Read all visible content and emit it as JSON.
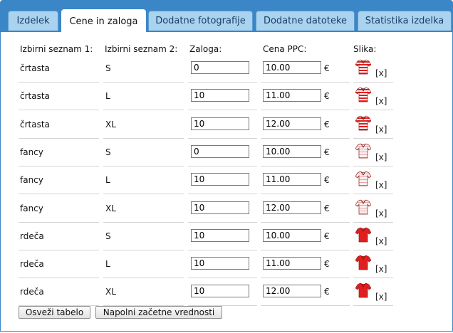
{
  "tabs": [
    {
      "label": "Izdelek"
    },
    {
      "label": "Cene in zaloga"
    },
    {
      "label": "Dodatne fotografije"
    },
    {
      "label": "Dodatne datoteke"
    },
    {
      "label": "Statistika izdelka"
    }
  ],
  "headers": {
    "list1": "Izbirni seznam 1:",
    "list2": "Izbirni seznam 2:",
    "stock": "Zaloga:",
    "price": "Cena PPC:",
    "image": "Slika:"
  },
  "rows": [
    {
      "opt1": "črtasta",
      "opt2": "S",
      "stock": "0",
      "price": "10.00",
      "currency": "€",
      "image": "striped-shirt",
      "remove": "[x]"
    },
    {
      "opt1": "črtasta",
      "opt2": "L",
      "stock": "10",
      "price": "11.00",
      "currency": "€",
      "image": "striped-shirt",
      "remove": "[x]"
    },
    {
      "opt1": "črtasta",
      "opt2": "XL",
      "stock": "10",
      "price": "12.00",
      "currency": "€",
      "image": "striped-shirt",
      "remove": "[x]"
    },
    {
      "opt1": "fancy",
      "opt2": "S",
      "stock": "0",
      "price": "10.00",
      "currency": "€",
      "image": "fancy-shirt",
      "remove": "[x]"
    },
    {
      "opt1": "fancy",
      "opt2": "L",
      "stock": "10",
      "price": "11.00",
      "currency": "€",
      "image": "fancy-shirt",
      "remove": "[x]"
    },
    {
      "opt1": "fancy",
      "opt2": "XL",
      "stock": "10",
      "price": "12.00",
      "currency": "€",
      "image": "fancy-shirt",
      "remove": "[x]"
    },
    {
      "opt1": "rdeča",
      "opt2": "S",
      "stock": "10",
      "price": "10.00",
      "currency": "€",
      "image": "red-shirt",
      "remove": "[x]"
    },
    {
      "opt1": "rdeča",
      "opt2": "L",
      "stock": "10",
      "price": "11.00",
      "currency": "€",
      "image": "red-shirt",
      "remove": "[x]"
    },
    {
      "opt1": "rdeča",
      "opt2": "XL",
      "stock": "10",
      "price": "12.00",
      "currency": "€",
      "image": "red-shirt",
      "remove": "[x]"
    }
  ],
  "buttons": {
    "refresh": "Osveži tabelo",
    "defaults": "Napolni začetne vrednosti"
  },
  "colors": {
    "tab_bar": "#3b86c6",
    "tab": "#a9d3ee",
    "shirt_red": "#e02020"
  }
}
